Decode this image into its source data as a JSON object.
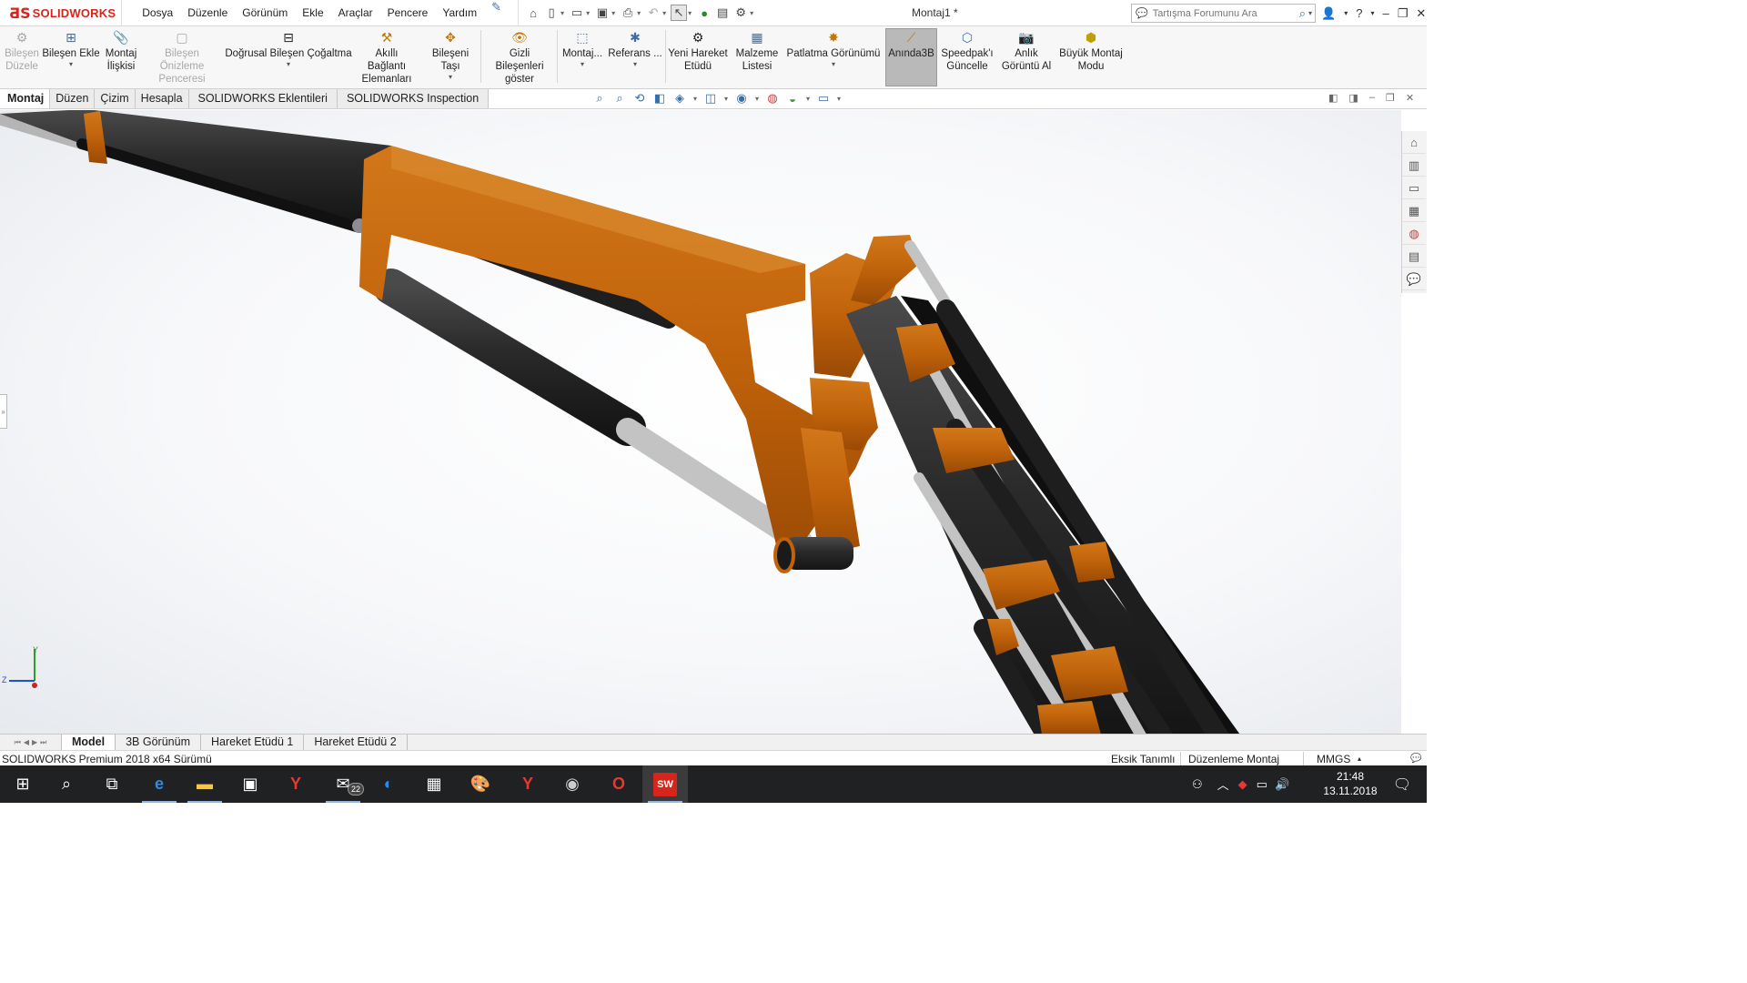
{
  "app": {
    "logo_text": "SOLIDWORKS",
    "document_title": "Montaj1 *",
    "brand_color": "#d7251b"
  },
  "menu": [
    "Dosya",
    "Düzenle",
    "Görünüm",
    "Ekle",
    "Araçlar",
    "Pencere",
    "Yardım"
  ],
  "search": {
    "placeholder": "Tartışma Forumunu Ara"
  },
  "ribbon": {
    "items": [
      {
        "label": "Bileşen Düzele",
        "icon": "component-edit-icon",
        "disabled": true
      },
      {
        "label": "Bileşen Ekle",
        "icon": "add-component-icon"
      },
      {
        "label": "Montaj İlişkisi",
        "icon": "mate-icon"
      },
      {
        "label": "Bileşen Önizleme Penceresi",
        "icon": "preview-window-icon",
        "disabled": true
      },
      {
        "label": "Doğrusal Bileşen Çoğaltma",
        "icon": "linear-pattern-icon"
      },
      {
        "label": "Akıllı Bağlantı Elemanları",
        "icon": "smart-fastener-icon"
      },
      {
        "label": "Bileşeni Taşı",
        "icon": "move-component-icon"
      },
      {
        "label": "Gizli Bileşenleri göster",
        "icon": "show-hidden-icon"
      },
      {
        "label": "Montaj...",
        "icon": "assembly-features-icon"
      },
      {
        "label": "Referans ...",
        "icon": "reference-geometry-icon"
      },
      {
        "label": "Yeni Hareket Etüdü",
        "icon": "motion-study-icon"
      },
      {
        "label": "Malzeme Listesi",
        "icon": "bill-of-materials-icon"
      },
      {
        "label": "Patlatma Görünümü",
        "icon": "exploded-view-icon"
      },
      {
        "label": "Anında3B",
        "icon": "instant3d-icon",
        "active": true
      },
      {
        "label": "Speedpak'ı Güncelle",
        "icon": "speedpak-icon"
      },
      {
        "label": "Anlık Görüntü Al",
        "icon": "snapshot-icon"
      },
      {
        "label": "Büyük Montaj Modu",
        "icon": "large-assembly-icon"
      }
    ]
  },
  "command_tabs": [
    "Montaj",
    "Düzen",
    "Çizim",
    "Hesapla",
    "SOLIDWORKS Eklentileri",
    "SOLIDWORKS Inspection"
  ],
  "active_command_tab": "Montaj",
  "viewport": {
    "triad_y": "Y",
    "triad_z": "Z",
    "part_color": "#c0620a",
    "cylinder_color": "#2e2e2e",
    "rod_color": "#c8c8c8"
  },
  "bottom_tabs": [
    "Model",
    "3B Görünüm",
    "Hareket Etüdü 1",
    "Hareket Etüdü 2"
  ],
  "active_bottom_tab": "Model",
  "status": {
    "version": "SOLIDWORKS Premium 2018 x64 Sürümü",
    "definition": "Eksik Tanımlı",
    "mode": "Düzenleme Montaj",
    "units": "MMGS"
  },
  "taskbar": {
    "mail_badge": "22",
    "sw_label": "SW",
    "time": "21:48",
    "date": "13.11.2018"
  }
}
